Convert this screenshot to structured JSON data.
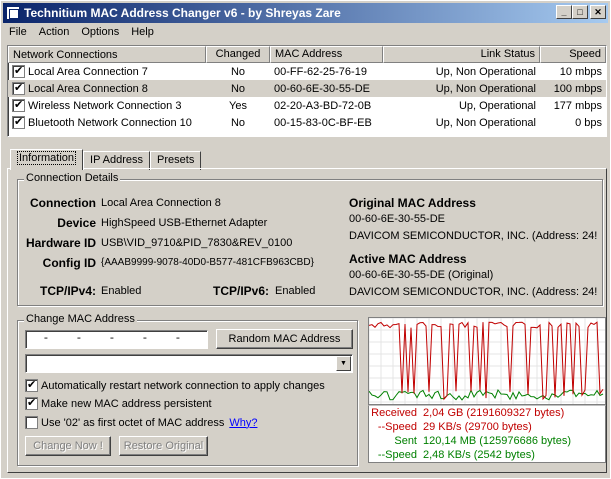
{
  "window": {
    "title": "Technitium MAC Address Changer v6 - by Shreyas Zare"
  },
  "menu": [
    "File",
    "Action",
    "Options",
    "Help"
  ],
  "connections_table": {
    "columns": [
      "Network Connections",
      "Changed",
      "MAC Address",
      "Link Status",
      "Speed"
    ],
    "rows": [
      {
        "checked": true,
        "name": "Local Area Connection 7",
        "changed": "No",
        "mac": "00-FF-62-25-76-19",
        "status": "Up, Non Operational",
        "speed": "10 mbps"
      },
      {
        "checked": true,
        "name": "Local Area Connection 8",
        "changed": "No",
        "mac": "00-60-6E-30-55-DE",
        "status": "Up, Non Operational",
        "speed": "100 mbps"
      },
      {
        "checked": true,
        "name": "Wireless Network Connection 3",
        "changed": "Yes",
        "mac": "02-20-A3-BD-72-0B",
        "status": "Up, Operational",
        "speed": "177 mbps"
      },
      {
        "checked": true,
        "name": "Bluetooth Network Connection 10",
        "changed": "No",
        "mac": "00-15-83-0C-BF-EB",
        "status": "Up, Non Operational",
        "speed": "0 bps"
      }
    ],
    "selected_index": 1
  },
  "tabs": [
    "Information",
    "IP Address",
    "Presets"
  ],
  "details": {
    "group_title": "Connection Details",
    "connection_label": "Connection",
    "connection_value": "Local Area Connection 8",
    "device_label": "Device",
    "device_value": "HighSpeed USB-Ethernet Adapter",
    "hwid_label": "Hardware ID",
    "hwid_value": "USB\\VID_9710&PID_7830&REV_0100",
    "configid_label": "Config ID",
    "configid_value": "{AAAB9999-9078-40D0-B577-481CFB963CBD}",
    "tcpipv4_label": "TCP/IPv4:",
    "tcpipv4_value": "Enabled",
    "tcpipv6_label": "TCP/IPv6:",
    "tcpipv6_value": "Enabled",
    "original_title": "Original MAC Address",
    "original_mac": "00-60-6E-30-55-DE",
    "original_vendor": "DAVICOM SEMICONDUCTOR, INC.  (Address: 24!",
    "active_title": "Active MAC Address",
    "active_mac": "00-60-6E-30-55-DE (Original)",
    "active_vendor": "DAVICOM SEMICONDUCTOR, INC.  (Address: 24!"
  },
  "change_mac": {
    "group_title": "Change MAC Address",
    "mac_input_mask": " -    -    -    -    - ",
    "random_button": "Random MAC Address",
    "vendor_combo_value": "",
    "opt_restart": {
      "checked": true,
      "label": "Automatically restart network connection to apply changes"
    },
    "opt_persistent": {
      "checked": true,
      "label": "Make new MAC address persistent"
    },
    "opt_02": {
      "checked": false,
      "label": "Use '02' as first octet of MAC address"
    },
    "why_link": "Why?",
    "change_button": "Change Now !",
    "restore_button": "Restore Original"
  },
  "traffic": {
    "received_label": "Received",
    "received_value": "2,04 GB (2191609327 bytes)",
    "rspeed_label": "--Speed",
    "rspeed_value": "29 KB/s (29700 bytes)",
    "sent_label": "Sent",
    "sent_value": "120,14 MB (125976686 bytes)",
    "sspeed_label": "--Speed",
    "sspeed_value": "2,48 KB/s (2542 bytes)",
    "received_color": "#c00000",
    "sent_color": "#008000"
  }
}
